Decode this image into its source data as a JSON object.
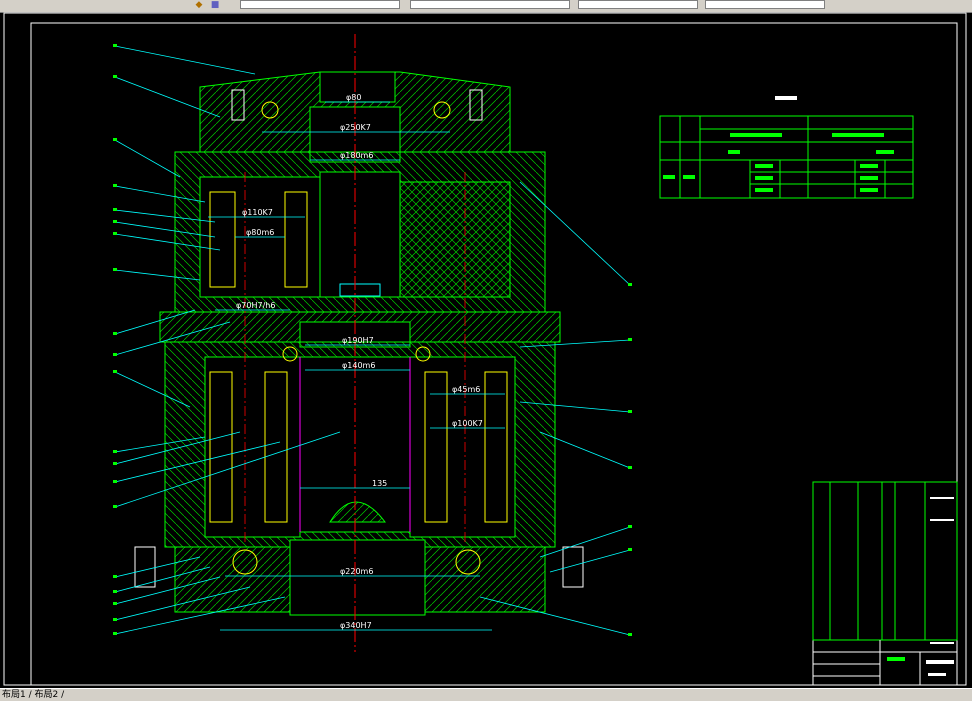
{
  "toolbar": {
    "icons": [
      "layer-icon",
      "cube-icon"
    ],
    "fields": [
      "",
      "",
      "",
      "",
      ""
    ]
  },
  "drawing": {
    "dimensions": {
      "d80": "φ80",
      "d250k7": "φ250K7",
      "d180m6": "φ180m6",
      "d110k7": "φ110K7",
      "d80m6": "φ80m6",
      "d70h7h6": "φ70H7/h6",
      "d190h7": "φ190H7",
      "d140m6": "φ140m6",
      "d45m6": "φ45m6",
      "d100k7": "φ100K7",
      "len135": "135",
      "d220m6": "φ220m6",
      "d340h7": "φ340H7"
    },
    "colors": {
      "outline": "#00ff00",
      "leader": "#00ffff",
      "centerline": "#ff0000",
      "yellow": "#ffff00",
      "magenta": "#ff00ff",
      "dimension": "#ffffff"
    }
  },
  "status": {
    "tabs": "布局1 / 布局2 /"
  }
}
